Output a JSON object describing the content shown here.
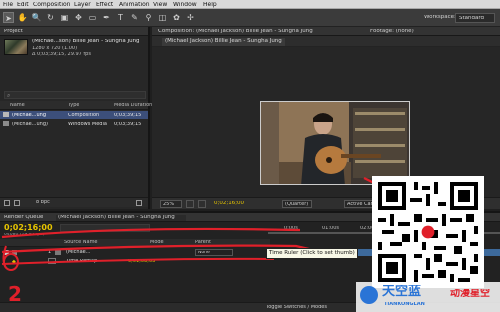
{
  "menu": [
    "File",
    "Edit",
    "Composition",
    "Layer",
    "Effect",
    "Animation",
    "View",
    "Window",
    "Help"
  ],
  "workspace": {
    "label": "Workspace:",
    "value": "Standard"
  },
  "project": {
    "tab": "Project",
    "selected_name": "(Michae...son) Billie Jean - Sungha Jung",
    "meta1": "1280 x 720 (1.00)",
    "meta2": "Δ 0;03;39;15, 29.97 fps",
    "columns": {
      "name": "Name",
      "type": "Type",
      "duration": "Media Duration"
    },
    "items": [
      {
        "name": "(Michae...ung",
        "type": "Composition",
        "duration": "0;03;39;15"
      },
      {
        "name": "(Michae...ung)",
        "type": "Windows Media",
        "duration": "0;03;39;15"
      }
    ],
    "bpc": "8 bpc"
  },
  "viewer": {
    "tab": "Composition: (Michael Jackson) Billie Jean - Sungha Jung",
    "subtab": "(Michael Jackson) Billie Jean - Sungha Jung",
    "footage_tab": "Footage: (none)",
    "zoom": "25%",
    "resolution": "(Quarter)",
    "camera": "Active Camera",
    "time": "0;02;16;00"
  },
  "render_queue": {
    "tab": "Render Queue",
    "comp_tab": "(Michael Jackson) Billie Jean - Sungha Jung"
  },
  "timeline": {
    "time": "0;02;16;00",
    "fps": "04080 (29.97 fps)",
    "cols": {
      "source": "Source Name",
      "mode": "Mode",
      "parent": "Parent"
    },
    "layers": [
      {
        "num": "1",
        "name": "(Michae...",
        "parent": "None"
      },
      {
        "name": "Time Remap",
        "value": "0;01;08;03"
      }
    ],
    "ruler_label": "Time Ruler (Click to set thumb)",
    "ruler_ticks": [
      "0:00s",
      "01:00s",
      "02:00s"
    ],
    "bottom": "Toggle Switches / Modes"
  },
  "annotation_number": "2",
  "watermark": {
    "brand": "天空蓝",
    "domain": "TIANKONGLAN",
    "tagline": "动漫星空"
  },
  "colors": {
    "highlight": "#e0202a",
    "selection": "#3c4f7a"
  }
}
